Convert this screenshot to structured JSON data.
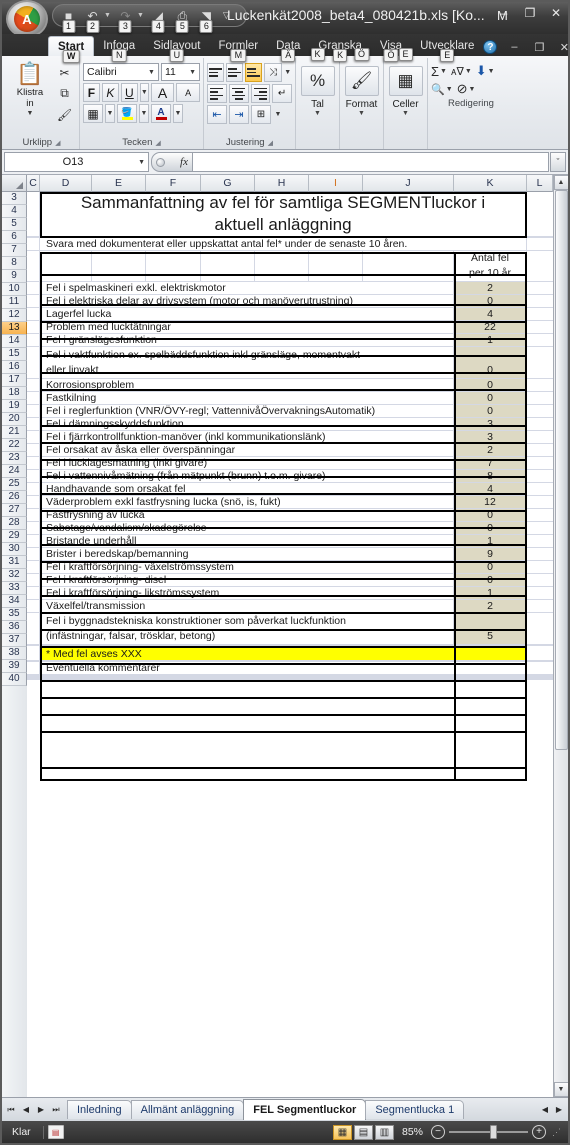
{
  "titlebar": {
    "title": "Luckenkät2008_beta4_080421b.xls  [Ko...",
    "title_keytip": "M",
    "orb_letter": "A",
    "qat": [
      {
        "name": "save",
        "glyph": "■",
        "keytip": "1"
      },
      {
        "name": "undo",
        "glyph": "↶",
        "keytip": "2",
        "has_caret": true
      },
      {
        "name": "redo",
        "glyph": "↷",
        "keytip": "3",
        "has_caret": true
      },
      {
        "name": "print-preview",
        "glyph": "◢",
        "keytip": "4"
      },
      {
        "name": "print",
        "glyph": "⎙",
        "keytip": "5"
      },
      {
        "name": "open",
        "glyph": "◥",
        "keytip": "6"
      }
    ],
    "qat_more": "▽",
    "window_buttons": [
      "–",
      "❐",
      "✕"
    ]
  },
  "ribbon": {
    "tabs": [
      {
        "label": "Start",
        "keytip": "W",
        "active": true
      },
      {
        "label": "Infoga",
        "keytip": "N",
        "active": false
      },
      {
        "label": "Sidlayout",
        "keytip": "U",
        "active": false
      },
      {
        "label": "Formler",
        "keytip": "M",
        "active": false
      },
      {
        "label": "Data",
        "keytip": "Ä",
        "active": false
      },
      {
        "label": "Granska",
        "keytip": "K",
        "active": false
      },
      {
        "label": "Visa",
        "keytip": "Ö",
        "active": false
      },
      {
        "label": "Utvecklare",
        "keytip": "E",
        "active": false
      }
    ],
    "help_label": "?",
    "tab_window_buttons": [
      "–",
      "❐",
      "✕"
    ],
    "groups": {
      "clipboard": {
        "label": "Urklipp",
        "paste_label": "Klistra\nin",
        "paste_icon": "📋",
        "cut_icon": "✂",
        "copy_icon": "⧉",
        "format_painter_icon": "🖌"
      },
      "font": {
        "label": "Tecken",
        "font_name": "Calibri",
        "font_size": "11",
        "bold": "F",
        "italic": "K",
        "underline": "U",
        "grow_font": "A",
        "shrink_font": "A",
        "borders_icon": "▦",
        "fill_icon": "🪣",
        "fontcolor_icon": "A",
        "fill_color": "#ffff00",
        "font_color": "#c00000"
      },
      "alignment": {
        "label": "Justering",
        "top_align": "≡",
        "middle_align": "≡",
        "bottom_align": "≡",
        "align_left": "≡",
        "align_center": "≡",
        "align_right": "≡",
        "orientation": "⤨",
        "wrap_text": "↵",
        "merge_center": "⊞",
        "decrease_indent": "⇤",
        "increase_indent": "⇥"
      },
      "number": {
        "label": "Tal",
        "icon": "%",
        "keytip": "K"
      },
      "styles": {
        "label": "Format",
        "icon": "🖌",
        "keytip": "Ö"
      },
      "cells": {
        "label": "Celler",
        "icon": "▦",
        "keytip": "E"
      },
      "editing": {
        "label": "Redigering",
        "autosum": "Σ",
        "fill": "⬇",
        "clear": "⊘",
        "sort_filter": "ᴀ∇",
        "find_select": "🔍"
      }
    }
  },
  "formula_bar": {
    "name_box": "O13",
    "fx_label": "fx",
    "formula_value": "",
    "expand_glyph": "ˇ"
  },
  "grid": {
    "columns": [
      "C",
      "D",
      "E",
      "F",
      "G",
      "H",
      "I",
      "J",
      "K",
      "L"
    ],
    "highlighted_column": "I",
    "selected_row": 13,
    "rows": [
      {
        "num": "3",
        "type": "title",
        "text": "Sammanfattning av fel för samtliga SEGMENTluckor i aktuell anläggning"
      },
      {
        "num": "4",
        "type": "blank"
      },
      {
        "num": "5",
        "type": "note",
        "text": "Svara med dokumenterat eller uppskattat antal fel* under de senaste 10 åren."
      },
      {
        "num": "6",
        "type": "header",
        "text": "",
        "value": "Antal fel\nper 10 år"
      },
      {
        "num": "7",
        "type": "data",
        "text": "Fel i spelmaskineri exkl. elektriskmotor",
        "value": "2"
      },
      {
        "num": "8",
        "type": "data",
        "text": "Fel i elektriska delar av drivsystem (motor och manöverutrustning)",
        "value": "0"
      },
      {
        "num": "9",
        "type": "data",
        "text": "Lagerfel lucka",
        "value": "4"
      },
      {
        "num": "10",
        "type": "data",
        "text": "Problem med lucktätningar",
        "value": "22"
      },
      {
        "num": "11",
        "type": "data",
        "text": "Fel i gränslägesfunktion",
        "value": "1"
      },
      {
        "num": "12",
        "type": "data2",
        "text": "Fel i vaktfunktion ex. spelbäddsfunktion inkl gränsläge,  momentvakt",
        "text2": "eller linvakt",
        "value": "0"
      },
      {
        "num": "13",
        "type": "data",
        "text": "Korrosionsproblem",
        "value": "0"
      },
      {
        "num": "14",
        "type": "data",
        "text": "Fastkilning",
        "value": "0"
      },
      {
        "num": "15",
        "type": "data",
        "text": "Fel i reglerfunktion (VNR/ÖVY-regl; VattennivåÖvervakningsAutomatik)",
        "value": "0"
      },
      {
        "num": "16",
        "type": "data",
        "text": "Fel i dämningsskyddsfunktion",
        "value": "3"
      },
      {
        "num": "17",
        "type": "data",
        "text": "Fel i fjärrkontrollfunktion-manöver (inkl kommunikationslänk)",
        "value": "3"
      },
      {
        "num": "18",
        "type": "data",
        "text": "Fel orsakat av åska eller överspänningar",
        "value": "2"
      },
      {
        "num": "19",
        "type": "data",
        "text": "Fel i lucklägesmätning (inkl givare)",
        "value": "7"
      },
      {
        "num": "20",
        "type": "data",
        "text": "Fel i vattennivåmätning (från mätpunkt (brunn) t.o.m. givare)",
        "value": "8"
      },
      {
        "num": "21",
        "type": "data",
        "text": "Handhavande som orsakat fel",
        "value": "4"
      },
      {
        "num": "22",
        "type": "data",
        "text": "Väderproblem exkl fastfrysning lucka (snö, is, fukt)",
        "value": "12"
      },
      {
        "num": "23",
        "type": "data",
        "text": "Fastfrysning av lucka",
        "value": "0"
      },
      {
        "num": "24",
        "type": "data",
        "text": "Sabotage/vandalism/skadegörelse",
        "value": "0"
      },
      {
        "num": "25",
        "type": "data",
        "text": "Bristande underhåll",
        "value": "1"
      },
      {
        "num": "26",
        "type": "data",
        "text": "Brister i beredskap/bemanning",
        "value": "9"
      },
      {
        "num": "27",
        "type": "data",
        "text": "Fel i kraftförsörjning- växelströmssystem",
        "value": "0"
      },
      {
        "num": "28",
        "type": "data",
        "text": "Fel i kraftförsörjning- disel",
        "value": "0"
      },
      {
        "num": "29",
        "type": "data",
        "text": "Fel i kraftförsörjning- likströmssystem",
        "value": "1"
      },
      {
        "num": "30",
        "type": "data",
        "text": "Växelfel/transmission",
        "value": "2"
      },
      {
        "num": "31",
        "type": "data2",
        "text": "Fel i byggnadstekniska konstruktioner som påverkat luckfunktion",
        "text2": "(infästningar, falsar, trösklar, betong)",
        "value": "5"
      },
      {
        "num": "32",
        "type": "blank"
      },
      {
        "num": "33",
        "type": "yellow",
        "text": "* Med fel avses XXX"
      },
      {
        "num": "34",
        "type": "blank"
      },
      {
        "num": "35",
        "type": "note",
        "text": "Eventuella kommentarer"
      },
      {
        "num": "36",
        "type": "comment-box"
      },
      {
        "num": "37",
        "type": "blank"
      },
      {
        "num": "38",
        "type": "blank"
      },
      {
        "num": "39",
        "type": "blank"
      },
      {
        "num": "40",
        "type": "blank"
      }
    ],
    "colors": {
      "value_cell_fill": "#ddd9c3",
      "note_fill": "#ffff00",
      "selected_header": "#f7b351"
    }
  },
  "sheet_tabs": {
    "nav": [
      "⏮",
      "◀",
      "▶",
      "⏭"
    ],
    "tabs": [
      {
        "label": "Inledning",
        "active": false
      },
      {
        "label": "Allmänt anläggning",
        "active": false
      },
      {
        "label": "FEL Segmentluckor",
        "active": true
      },
      {
        "label": "Segmentlucka 1",
        "active": false
      }
    ],
    "scroll_right": [
      "◀",
      "▶"
    ]
  },
  "statusbar": {
    "status": "Klar",
    "macro_icon": "▤",
    "views": [
      {
        "name": "normal",
        "glyph": "▦",
        "active": true
      },
      {
        "name": "page-layout",
        "glyph": "▤",
        "active": false
      },
      {
        "name": "page-break-preview",
        "glyph": "▥",
        "active": false
      }
    ],
    "zoom": "85%",
    "zoom_minus": "−",
    "zoom_plus": "+",
    "grip": "⋰"
  }
}
